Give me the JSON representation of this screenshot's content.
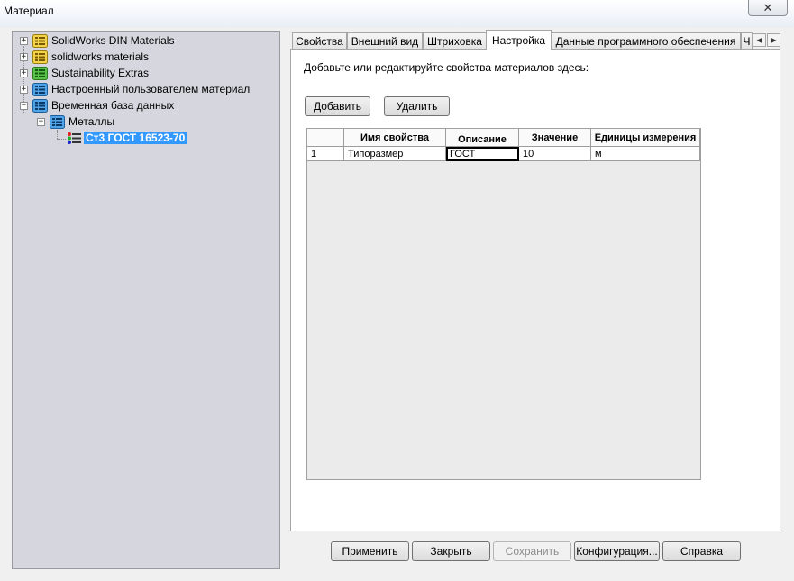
{
  "window": {
    "title": "Материал",
    "close_label": "✕"
  },
  "tree": {
    "items": [
      {
        "label": "SolidWorks DIN Materials",
        "expander": "+"
      },
      {
        "label": "solidworks materials",
        "expander": "+"
      },
      {
        "label": "Sustainability Extras",
        "expander": "+"
      },
      {
        "label": "Настроенный пользователем материал",
        "expander": "+"
      },
      {
        "label": "Временная база данных",
        "expander": "−"
      },
      {
        "label": "Металлы",
        "expander": "−"
      },
      {
        "label": "Ст3 ГОСТ 16523-70",
        "selected": true
      }
    ]
  },
  "tabs": [
    {
      "label": "Свойства"
    },
    {
      "label": "Внешний вид"
    },
    {
      "label": "Штриховка"
    },
    {
      "label": "Настройка",
      "active": true
    },
    {
      "label": "Данные программного обеспечения"
    },
    {
      "label": "Ч"
    }
  ],
  "tab_scroll": {
    "left": "◀",
    "right": "▶"
  },
  "panel": {
    "instruction": "Добавьте или редактируйте свойства материалов здесь:",
    "add_label": "Добавить",
    "delete_label": "Удалить"
  },
  "grid": {
    "columns": [
      "",
      "Имя свойства",
      "Описание",
      "Значение",
      "Единицы измерения"
    ],
    "rows": [
      {
        "num": "1",
        "name": "Типоразмер",
        "description": "ГОСТ",
        "value": "10",
        "units": "м"
      }
    ]
  },
  "footer": {
    "apply": "Применить",
    "close": "Закрыть",
    "save": "Сохранить",
    "config": "Конфигурация...",
    "help": "Справка"
  },
  "colors": {
    "selection": "#3399ff",
    "tree_bg": "#d6d7de",
    "grid_bg": "#ebebeb"
  }
}
